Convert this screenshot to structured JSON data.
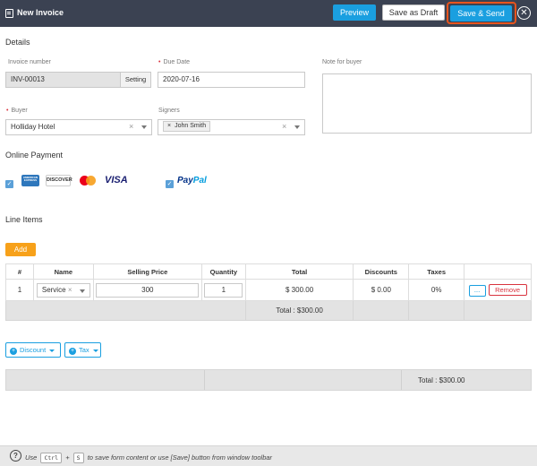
{
  "window": {
    "title": "New Invoice",
    "buttons": {
      "preview": "Preview",
      "save_draft": "Save as Draft",
      "save_send": "Save & Send",
      "close": "✕"
    }
  },
  "details": {
    "section_title": "Details",
    "invoice_number": {
      "label": "Invoice number",
      "value": "INV-00013",
      "setting_label": "Setting"
    },
    "due_date": {
      "label": "Due Date",
      "value": "2020-07-16"
    },
    "note": {
      "label": "Note for buyer",
      "value": ""
    },
    "buyer": {
      "label": "Buyer",
      "value": "Holliday Hotel"
    },
    "signers": {
      "label": "Signers",
      "tags": [
        "John Smith"
      ]
    }
  },
  "online_payment": {
    "section_title": "Online Payment",
    "cards": [
      "AMERICAN EXPRESS",
      "DISCOVER",
      "mastercard",
      "VISA"
    ],
    "cards_checked": true,
    "paypal": {
      "pay": "Pay",
      "pal": "Pal",
      "checked": true
    }
  },
  "line_items": {
    "section_title": "Line Items",
    "add_label": "Add",
    "columns": [
      "#",
      "Name",
      "Selling Price",
      "Quantity",
      "Total",
      "Discounts",
      "Taxes"
    ],
    "rows": [
      {
        "index": "1",
        "name": "Service",
        "price": "300",
        "quantity": "1",
        "total": "$ 300.00",
        "discount": "$ 0.00",
        "tax": "0%",
        "more_label": "...",
        "remove_label": "Remove"
      }
    ],
    "total_label": "Total : $300.00"
  },
  "adjustments": {
    "discount_label": "Discount",
    "tax_label": "Tax"
  },
  "summary": {
    "total_label": "Total : $300.00"
  },
  "statusbar": {
    "use": "Use",
    "key1": "Ctrl",
    "plus": "+",
    "key2": "S",
    "rest": "to save form content or use [Save] button from window toolbar"
  },
  "colors": {
    "primary": "#1a9fe0",
    "titlebar": "#3b4252",
    "add": "#f7a11a",
    "danger": "#d9333f",
    "highlight": "#e8541d"
  }
}
